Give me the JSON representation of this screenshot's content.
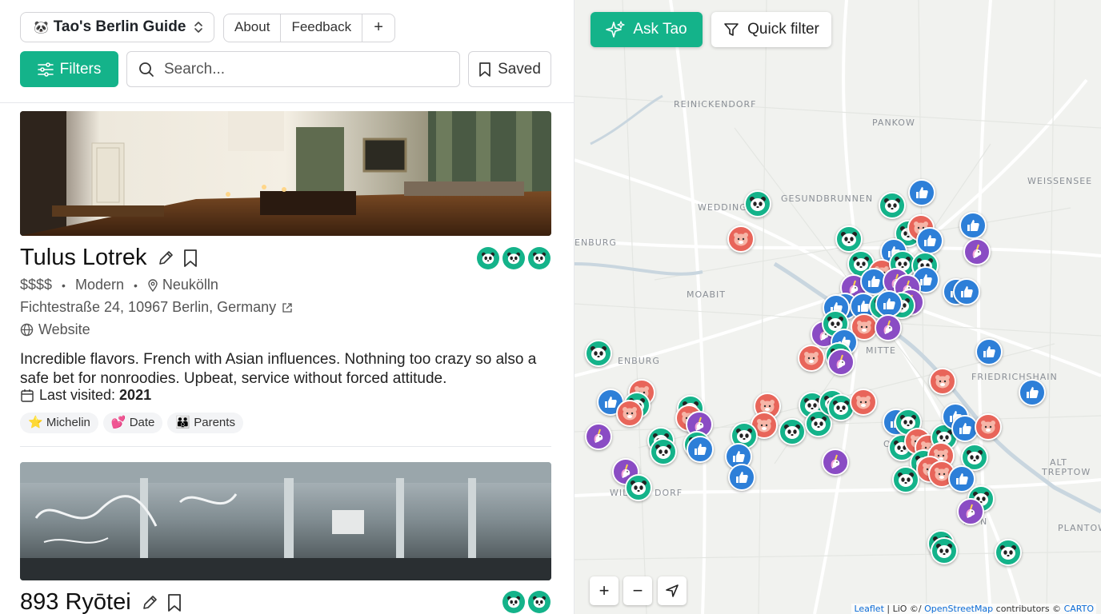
{
  "header": {
    "guide_emoji": "🐼",
    "guide_name": "Tao's Berlin Guide",
    "nav": [
      "About",
      "Feedback",
      "+"
    ],
    "filters_label": "Filters",
    "search_placeholder": "Search...",
    "saved_label": "Saved"
  },
  "colors": {
    "accent": "#14b38a",
    "panda": "#14b38a",
    "bear": "#e8655a",
    "like": "#2d7fd8",
    "unicorn": "#8a4cc4"
  },
  "cards": [
    {
      "title": "Tulus Lotrek",
      "rating_icons": [
        "panda-icon",
        "panda-icon",
        "panda-icon"
      ],
      "price": "$$$$",
      "cuisine": "Modern",
      "district": "Neukölln",
      "address": "Fichtestraße 24, 10967 Berlin, Germany",
      "website": "Website",
      "description": "Incredible flavors. French with Asian influences. Nothning too crazy so also a safe bet for nonroodies. Upbeat, service without forced attitude.",
      "last_visited_label": "Last visited:",
      "last_visited": "2021",
      "tags": [
        "⭐ Michelin",
        "💕 Date",
        "👪 Parents"
      ]
    },
    {
      "title": "893 Ryōtei",
      "rating_icons": [
        "panda-icon",
        "panda-icon"
      ]
    }
  ],
  "map": {
    "ask_label": "Ask Tao",
    "quick_filter_label": "Quick filter",
    "district_labels": [
      "REINICKENDORF",
      "PANKOW",
      "WEISSENSEE",
      "WEDDING",
      "GESUNDBRUNNEN",
      "ENBURG",
      "MOABIT",
      "MITTE",
      "ENBURG",
      "FRIEDRICHSHAIN",
      "ALT",
      "TREPTOW",
      "WIL",
      "DORF",
      "HE",
      "N",
      "PLANTOW",
      "OR"
    ],
    "zoom_in": "+",
    "zoom_out": "−",
    "attribution": {
      "leaflet": "Leaflet",
      "sep": " | LiO ©/ ",
      "osm": "OpenStreetMap",
      "rest": " contributors © ",
      "carto": "CARTO"
    },
    "marker_types": [
      "panda",
      "bear",
      "like",
      "unicorn"
    ]
  }
}
